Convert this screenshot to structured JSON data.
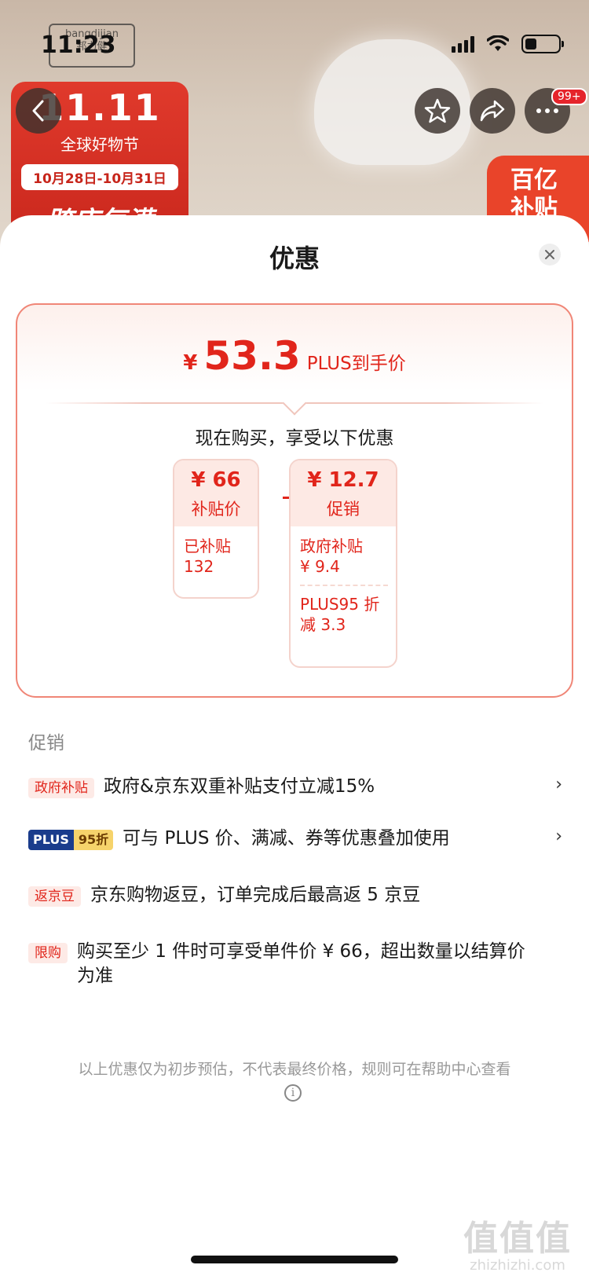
{
  "status_bar": {
    "time": "11:23"
  },
  "background": {
    "brand": "bangdijian\n邦力健",
    "promo_logo": "11.11",
    "promo_sub": "全球好物节",
    "promo_date": "10月28日-10月31日",
    "promo_big": "跨店每满",
    "badge": "百亿\n补贴",
    "message_badge": "99+"
  },
  "sheet": {
    "title": "优惠",
    "final_price": {
      "currency": "¥",
      "amount": "53.3",
      "label": "PLUS到手价"
    },
    "buy_text": "现在购买，享受以下优惠",
    "subsidy_box": {
      "amount": "¥ 66",
      "caption": "补贴价",
      "detail_1": "已补贴",
      "detail_2": "132"
    },
    "promo_box": {
      "amount": "¥ 12.7",
      "caption": "促销",
      "detail_1a": "政府补贴",
      "detail_1b": "¥ 9.4",
      "detail_2a": "PLUS95 折",
      "detail_2b": "减 3.3"
    },
    "promo_section_title": "促销",
    "promotions": [
      {
        "tag": "政府补贴",
        "text": "政府&京东双重补贴支付立减15%",
        "chevron": "›"
      },
      {
        "tag_plus": "PLUS",
        "tag_discount": "95折",
        "text": "可与 PLUS 价、满减、券等优惠叠加使用",
        "chevron": "›"
      },
      {
        "tag": "返京豆",
        "text": "京东购物返豆，订单完成后最高返 5 京豆"
      },
      {
        "tag": "限购",
        "text": "购买至少 1 件时可享受单件价 ¥ 66，超出数量以结算价为准"
      }
    ],
    "disclaimer": "以上优惠仅为初步预估，不代表最终价格，规则可在帮助中心查看",
    "info_glyph": "i"
  },
  "watermark": {
    "big": "值值值",
    "small": "zhizhizhi.com"
  }
}
